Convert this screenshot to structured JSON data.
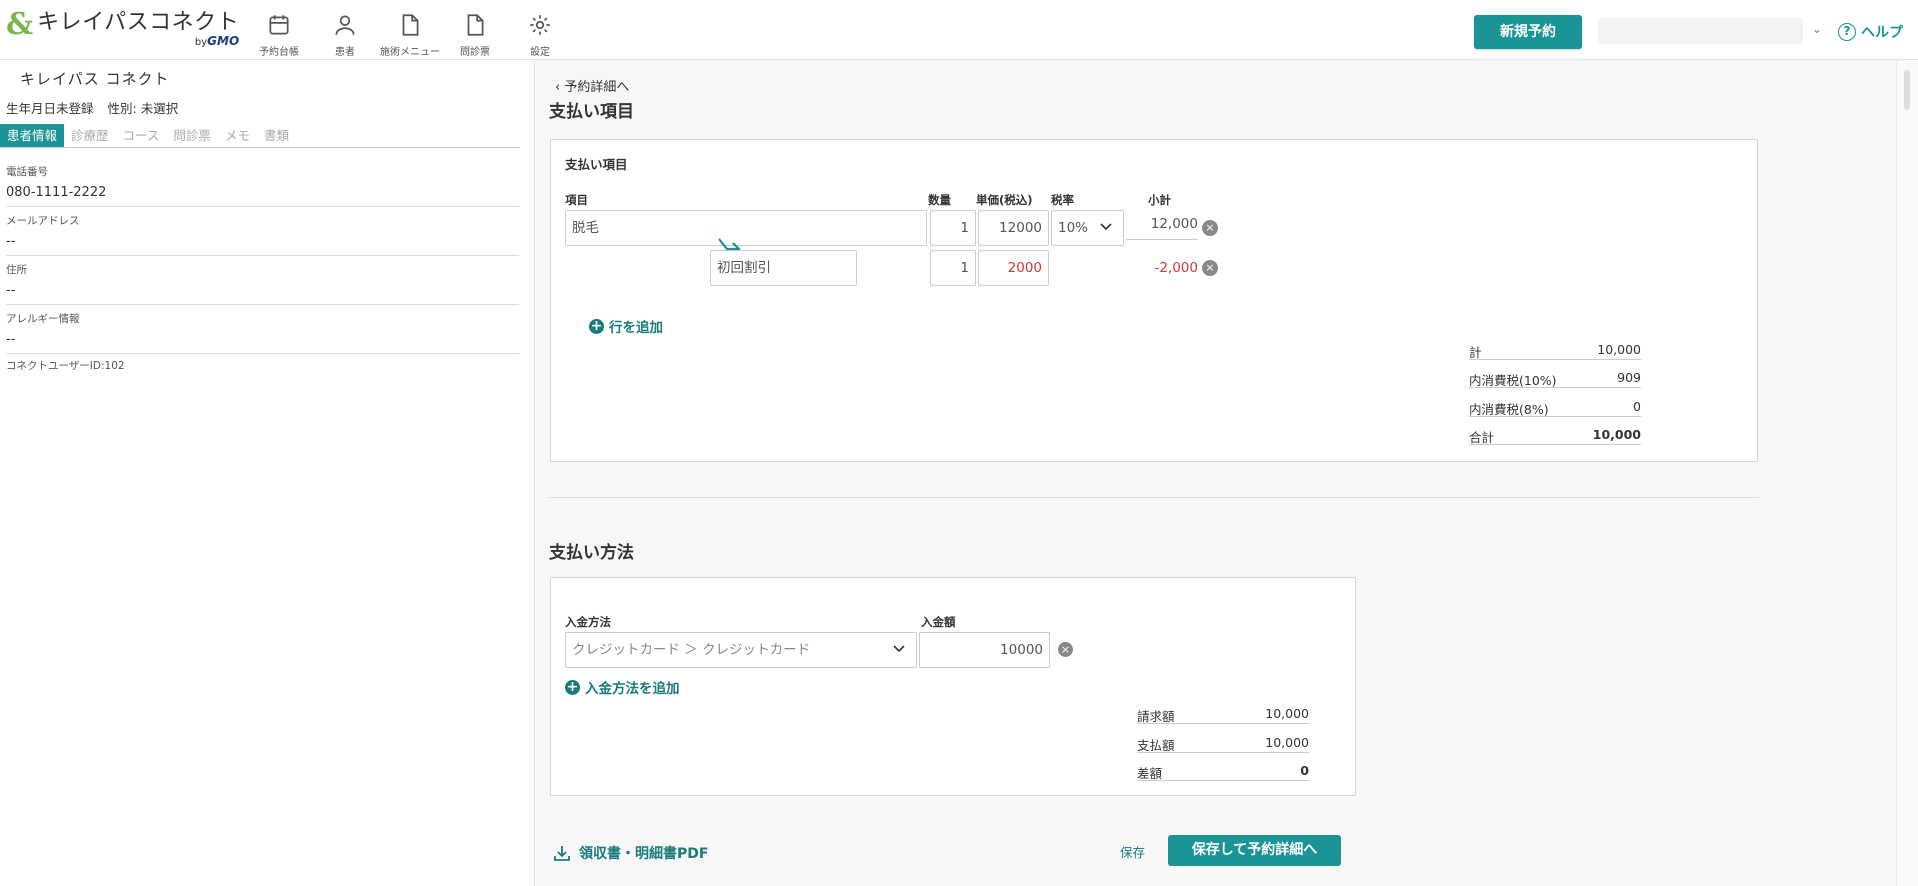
{
  "header": {
    "logo_name": "キレイパスコネクト",
    "logo_by": "by",
    "logo_brand": "GMO",
    "nav": [
      {
        "label": "予約台帳",
        "icon": "calendar-icon"
      },
      {
        "label": "患者",
        "icon": "person-icon"
      },
      {
        "label": "施術メニュー",
        "icon": "document-icon"
      },
      {
        "label": "問診票",
        "icon": "document-icon"
      },
      {
        "label": "設定",
        "icon": "gear-icon"
      }
    ],
    "new_booking": "新規予約",
    "help": "ヘルプ"
  },
  "patient": {
    "clinic_name": "キレイパス コネクト",
    "birthdate": "生年月日未登録",
    "gender": "性別: 未選択",
    "tabs": [
      "患者情報",
      "診療歴",
      "コース",
      "問診票",
      "メモ",
      "書類"
    ],
    "fields": [
      {
        "label": "電話番号",
        "value": "080-1111-2222"
      },
      {
        "label": "メールアドレス",
        "value": "--"
      },
      {
        "label": "住所",
        "value": "--"
      },
      {
        "label": "アレルギー情報",
        "value": "--"
      }
    ],
    "connect_user_id": "コネクトユーザーID:102"
  },
  "main": {
    "back_link": "予約詳細へ",
    "payment_items_heading": "支払い項目",
    "payment_card": {
      "title": "支払い項目",
      "col_item": "項目",
      "col_qty": "数量",
      "col_price": "単価(税込)",
      "col_tax": "税率",
      "col_subtotal": "小計",
      "rows": [
        {
          "item": "脱毛",
          "qty": "1",
          "price": "12000",
          "tax": "10%",
          "subtotal": "12,000"
        },
        {
          "item": "初回割引",
          "qty": "1",
          "price": "2000",
          "subtotal": "-2,000"
        }
      ],
      "add_row": "行を追加",
      "summary": [
        {
          "label": "計",
          "value": "10,000"
        },
        {
          "label": "内消費税(10%)",
          "value": "909"
        },
        {
          "label": "内消費税(8%)",
          "value": "0"
        },
        {
          "label": "合計",
          "value": "10,000"
        }
      ]
    },
    "payment_method_heading": "支払い方法",
    "method_card": {
      "col_method": "入金方法",
      "col_amount": "入金額",
      "method_value": "クレジットカード ＞ クレジットカード",
      "amount_value": "10000",
      "add_method": "入金方法を追加",
      "summary": [
        {
          "label": "請求額",
          "value": "10,000"
        },
        {
          "label": "支払額",
          "value": "10,000"
        },
        {
          "label": "差額",
          "value": "0"
        }
      ]
    },
    "pdf_link": "領収書・明細書PDF",
    "save": "保存",
    "save_and_go": "保存して予約詳細へ"
  },
  "colors": {
    "accent": "#1a9494",
    "negative": "#d0383a",
    "logo_green": "#7ab648"
  }
}
